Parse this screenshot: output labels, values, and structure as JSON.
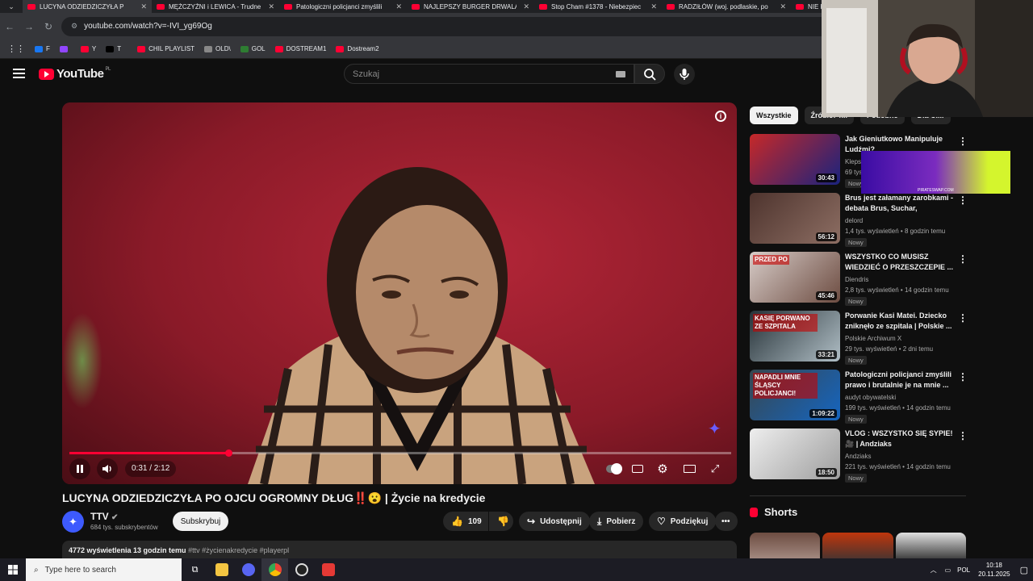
{
  "browser": {
    "tabs": [
      {
        "label": "LUCYNA ODZIEDZICZYŁA P",
        "active": true
      },
      {
        "label": "MĘŻCZYŹNI i LEWICA - Trudne"
      },
      {
        "label": "Patologiczni policjanci zmyślili"
      },
      {
        "label": "NAJLEPSZY BURGER DRWALA"
      },
      {
        "label": "Stop Cham #1378 - Niebezpiec"
      },
      {
        "label": "RADZIŁÓW (woj. podlaskie, po"
      },
      {
        "label": "NIE K"
      }
    ],
    "url": "youtube.com/watch?v=-IVI_yg69Og",
    "bookmarks": [
      {
        "label": "F",
        "color": "#1877f2"
      },
      {
        "label": "",
        "color": "#9146ff"
      },
      {
        "label": "Y",
        "color": "#ff0033"
      },
      {
        "label": "T",
        "color": "#000000"
      },
      {
        "label": "CHIL PLAYLIST",
        "color": "#ff0033"
      },
      {
        "label": "OLD\\",
        "color": "#888888"
      },
      {
        "label": "GOL",
        "color": "#2e7d32"
      },
      {
        "label": "DOSTREAM1",
        "color": "#ff0033"
      },
      {
        "label": "Dostream2",
        "color": "#ff0033"
      }
    ]
  },
  "header": {
    "logo_text": "YouTube",
    "region": "PL",
    "search_placeholder": "Szukaj"
  },
  "player": {
    "time": "0:31 / 2:12",
    "progress": 0.24
  },
  "video": {
    "title": "LUCYNA ODZIEDZICZYŁA PO OJCU OGROMNY DŁUG‼️😮 | Życie na kredycie",
    "channel": "TTV",
    "subscribers": "684 tys. subskrybentów",
    "subscribe_label": "Subskrybuj",
    "likes": "109",
    "share_label": "Udostępnij",
    "download_label": "Pobierz",
    "thanks_label": "Podziękuj",
    "views_line": "4772 wyświetlenia  13 godzin temu",
    "tags": "#ttv #życienakredycie #playerpl"
  },
  "sidebar": {
    "chips": [
      "Wszystkie",
      "Źródło: T...",
      "Podobne",
      "Dla Ci..."
    ],
    "recommendations": [
      {
        "title": "Jak Gieniutkowo Manipuluje Ludźmi?",
        "channel": "Klepsy",
        "meta": "69 tys.",
        "badge": "Nowy",
        "duration": "30:43",
        "color1": "#c62828",
        "color2": "#1a237e"
      },
      {
        "title": "Brus jest załamany zarobkami - debata Brus, Suchar, Overpow,...",
        "channel": "delord",
        "meta": "1,4 tys. wyświetleń • 8 godzin temu",
        "badge": "Nowy",
        "duration": "56:12",
        "color1": "#4e342e",
        "color2": "#8d6e63"
      },
      {
        "title": "WSZYSTKO CO MUSISZ WIEDZIEĆ O PRZESZCZEPIE ...",
        "channel": "Diendris",
        "meta": "2,8 tys. wyświetleń • 14 godzin temu",
        "badge": "Nowy",
        "duration": "45:46",
        "color1": "#d7ccc8",
        "color2": "#6d4c41",
        "thumb_text": "PRZED   PO"
      },
      {
        "title": "Porwanie Kasi Matei. Dziecko zniknęło ze szpitala | Polskie ...",
        "channel": "Polskie Archiwum X",
        "meta": "29 tys. wyświetleń • 2 dni temu",
        "badge": "Nowy",
        "duration": "33:21",
        "color1": "#263238",
        "color2": "#b0bec5",
        "thumb_text": "KASIĘ PORWANO ZE SZPITALA"
      },
      {
        "title": "Patologiczni policjanci zmyślili prawo i brutalnie je na mnie ...",
        "channel": "audyt obywatelski",
        "meta": "199 tys. wyświetleń • 14 godzin temu",
        "badge": "Nowy",
        "duration": "1:09:22",
        "color1": "#37474f",
        "color2": "#1565c0",
        "thumb_text": "NAPADLI MNIE ŚLĄSCY POLICJANCI!"
      },
      {
        "title": "VLOG : WSZYSTKO SIĘ SYPIE! 🎥 | Andziaks",
        "channel": "Andziaks",
        "meta": "221 tys. wyświetleń • 14 godzin temu",
        "badge": "Nowy",
        "duration": "18:50",
        "color1": "#eeeeee",
        "color2": "#9e9e9e"
      }
    ],
    "shorts_label": "Shorts"
  },
  "ad": {
    "text": "PIRATESWAP.COM"
  },
  "taskbar": {
    "search_placeholder": "Type here to search",
    "lang": "POL",
    "time": "10:18",
    "date": "20.11.2025"
  }
}
